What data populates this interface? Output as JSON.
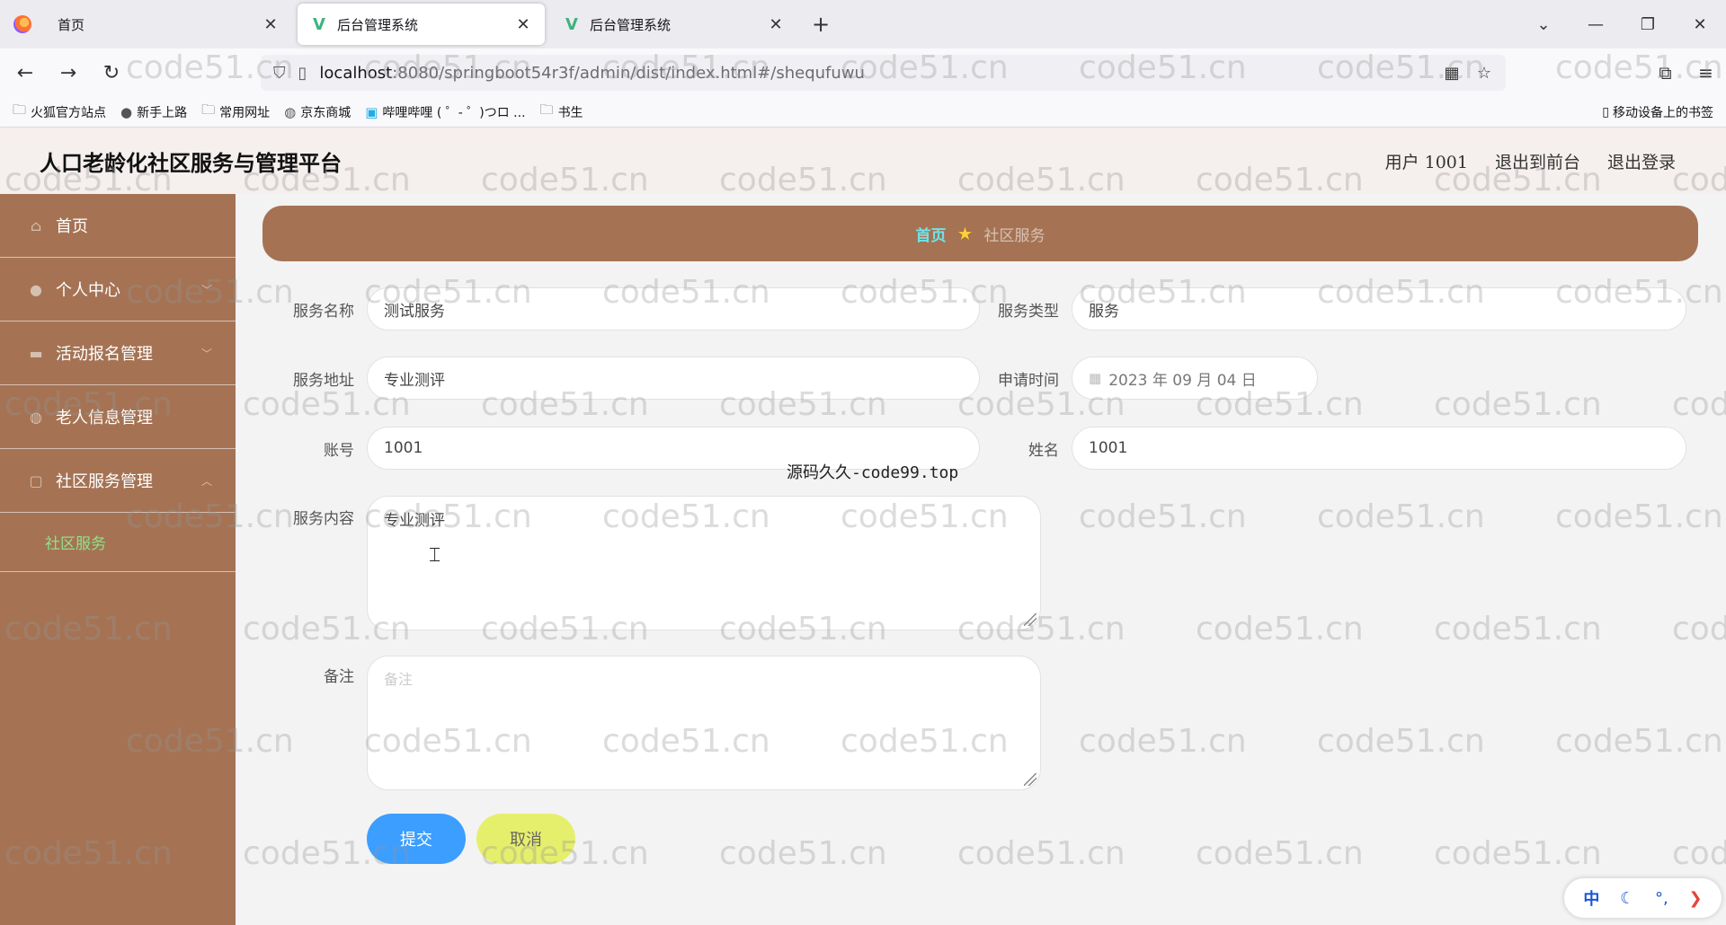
{
  "browser": {
    "tabs": [
      {
        "title": "首页",
        "active": false
      },
      {
        "title": "后台管理系统",
        "active": true
      },
      {
        "title": "后台管理系统",
        "active": false
      }
    ],
    "url_host": "localhost",
    "url_rest": ":8080/springboot54r3f/admin/dist/index.html#/shequfuwu",
    "bookmarks": [
      "火狐官方站点",
      "新手上路",
      "常用网址",
      "京东商城",
      "哔哩哔哩 ( ゜- ゜)つロ ...",
      "书生"
    ],
    "mobile_bookmarks": "移动设备上的书签"
  },
  "header": {
    "title": "人口老龄化社区服务与管理平台",
    "user": "用户 1001",
    "to_front": "退出到前台",
    "logout": "退出登录"
  },
  "sidebar": {
    "items": [
      {
        "label": "首页",
        "icon": "home-icon"
      },
      {
        "label": "个人中心",
        "icon": "user-icon"
      },
      {
        "label": "活动报名管理",
        "icon": "briefcase-icon"
      },
      {
        "label": "老人信息管理",
        "icon": "globe-icon"
      },
      {
        "label": "社区服务管理",
        "icon": "square-icon"
      }
    ],
    "sub_item": "社区服务"
  },
  "breadcrumb": {
    "home": "首页",
    "current": "社区服务"
  },
  "form": {
    "service_name_label": "服务名称",
    "service_name": "测试服务",
    "service_type_label": "服务类型",
    "service_type": "服务",
    "service_address_label": "服务地址",
    "service_address": "专业测评",
    "apply_time_label": "申请时间",
    "apply_time": "2023 年 09 月 04 日",
    "account_label": "账号",
    "account": "1001",
    "name_label": "姓名",
    "name": "1001",
    "content_label": "服务内容",
    "content": "专业测评",
    "remark_label": "备注",
    "remark_placeholder": "备注",
    "submit": "提交",
    "cancel": "取消"
  },
  "overlay_text": "源码久久-code99.top",
  "watermark": "code51.cn",
  "ime": {
    "lang": "中"
  }
}
